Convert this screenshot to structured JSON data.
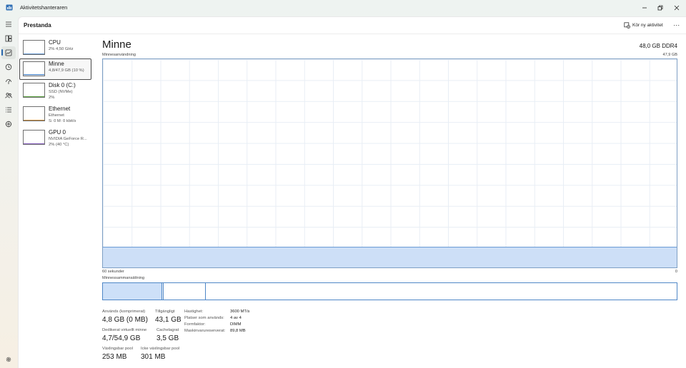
{
  "window": {
    "title": "Aktivitetshanteraren",
    "controls": [
      "minimize-icon",
      "restore-icon",
      "close-icon"
    ]
  },
  "header": {
    "page_title": "Prestanda",
    "run_task_label": "Kör ny aktivitet",
    "more_label": "..."
  },
  "nav": {
    "items": [
      {
        "name": "menu-icon"
      },
      {
        "name": "processes-icon"
      },
      {
        "name": "performance-icon",
        "active": true
      },
      {
        "name": "app-history-icon"
      },
      {
        "name": "startup-apps-icon"
      },
      {
        "name": "users-icon"
      },
      {
        "name": "details-icon"
      },
      {
        "name": "services-icon"
      }
    ],
    "settings": {
      "name": "gear-icon"
    }
  },
  "sidebar": {
    "items": [
      {
        "name": "CPU",
        "sub1": "2% 4,50 GHz",
        "sub2": "",
        "sub3": "",
        "level": 0.02
      },
      {
        "name": "Minne",
        "sub1": "4,8/47,9 GB (10 %)",
        "sub2": "",
        "sub3": "",
        "level": 0.1,
        "selected": true
      },
      {
        "name": "Disk 0 (C:)",
        "sub1": "SSD (NVMe)",
        "sub2": "2%",
        "sub3": "",
        "level": 0.02
      },
      {
        "name": "Ethernet",
        "sub1": "Ethernet",
        "sub2": "S: 0 M: 0 kbit/s",
        "sub3": "",
        "level": 0.0
      },
      {
        "name": "GPU 0",
        "sub1": "NVIDIA GeForce R...",
        "sub2": "2% (40 °C)",
        "sub3": "",
        "level": 0.02
      }
    ]
  },
  "main": {
    "title": "Minne",
    "spec": "48,0 GB DDR4",
    "usage_label": "Minnesanvändning",
    "usage_max": "47,9 GB",
    "time_label_left": "60 sekunder",
    "time_label_right": "0",
    "composition_label": "Minnessammansättning",
    "usage_level": 0.1,
    "composition": {
      "in_use": 0.103,
      "modified": 0.003,
      "standby": 0.073
    },
    "colors": {
      "accent": "#4f87c7",
      "fill": "#cde0f8",
      "grid": "#e8eef5"
    }
  },
  "stats": {
    "in_use_label": "Används (komprimerat)",
    "in_use_value": "4,8 GB (0 MB)",
    "available_label": "Tillgängligt",
    "available_value": "43,1 GB",
    "committed_label": "Dedikerat virtuellt minne",
    "committed_value": "4,7/54,9 GB",
    "cached_label": "Cachelagrat",
    "cached_value": "3,5 GB",
    "paged_label": "Växlingsbar pool",
    "paged_value": "253 MB",
    "nonpaged_label": "Icke växlingsbar pool",
    "nonpaged_value": "301 MB"
  },
  "properties": [
    {
      "label": "Hastighet:",
      "value": "3600 MT/s"
    },
    {
      "label": "Platser som används:",
      "value": "4 av 4"
    },
    {
      "label": "Formfaktor:",
      "value": "DIMM"
    },
    {
      "label": "Maskinvarureserverat:",
      "value": "89,8 MB"
    }
  ]
}
